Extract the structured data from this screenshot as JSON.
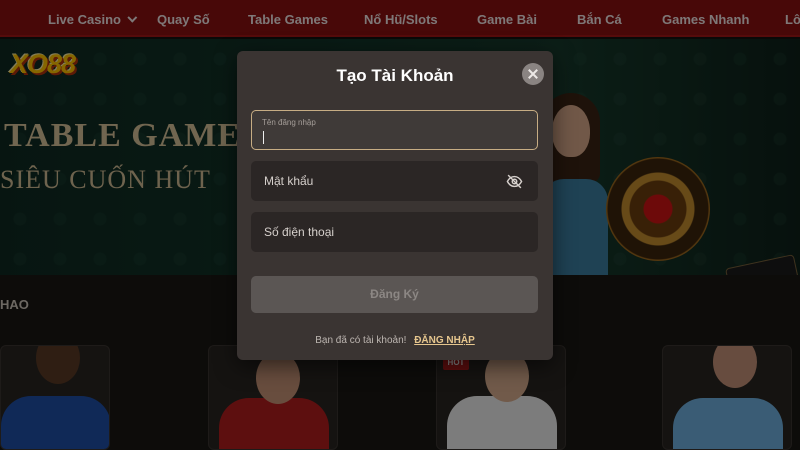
{
  "nav": {
    "items": [
      {
        "label": "Live Casino",
        "dropdown": true
      },
      {
        "label": "Quay Số"
      },
      {
        "label": "Table Games"
      },
      {
        "label": "Nổ Hũ/Slots"
      },
      {
        "label": "Game Bài"
      },
      {
        "label": "Bắn Cá"
      },
      {
        "label": "Games Nhanh"
      },
      {
        "label": "Lô"
      }
    ]
  },
  "brand": {
    "logo_text": "XO88"
  },
  "hero": {
    "title": "TABLE GAMES",
    "subtitle": "SIÊU CUỐN HÚT"
  },
  "section": {
    "label": "HAO",
    "badge": "HOT"
  },
  "modal": {
    "title": "Tạo Tài Khoản",
    "username_label": "Tên đăng nhập",
    "password_placeholder": "Mật khẩu",
    "phone_placeholder": "Số điện thoại",
    "submit_label": "Đăng Ký",
    "have_account_text": "Bạn đã có tài khoản!",
    "login_link": "ĐĂNG NHẬP"
  },
  "colors": {
    "nav_bg": "#8a1010",
    "modal_bg": "#3a3432",
    "accent": "#e6c68e",
    "focus_border": "#c7ad84"
  },
  "icons": [
    "chevron-down-icon",
    "close-icon",
    "eye-off-icon"
  ]
}
